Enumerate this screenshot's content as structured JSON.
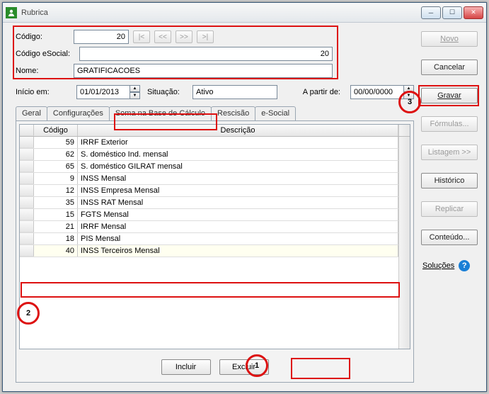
{
  "window": {
    "title": "Rubrica"
  },
  "titlebar_buttons": {
    "min": "─",
    "max": "☐",
    "close": "✕"
  },
  "header": {
    "codigo_label": "Código:",
    "codigo_value": "20",
    "nav": {
      "first": "|<",
      "prev": "<<",
      "next": ">>",
      "last": ">|"
    },
    "esocial_label": "Código eSocial:",
    "esocial_value": "20",
    "nome_label": "Nome:",
    "nome_value": "GRATIFICACOES"
  },
  "meta": {
    "inicio_label": "Início em:",
    "inicio_value": "01/01/2013",
    "situacao_label": "Situação:",
    "situacao_value": "Ativo",
    "apartir_label": "A partir de:",
    "apartir_value": "00/00/0000"
  },
  "tabs": {
    "geral": "Geral",
    "config": "Configurações",
    "soma": "Soma na Base de Cálculo",
    "rescisao": "Rescisão",
    "esocial": "e-Social"
  },
  "grid": {
    "col_codigo": "Código",
    "col_desc": "Descrição",
    "rows": [
      {
        "codigo": "59",
        "desc": "IRRF Exterior"
      },
      {
        "codigo": "62",
        "desc": "S. doméstico Ind. mensal"
      },
      {
        "codigo": "65",
        "desc": "S. doméstico GILRAT mensal"
      },
      {
        "codigo": "9",
        "desc": "INSS Mensal"
      },
      {
        "codigo": "12",
        "desc": "INSS Empresa Mensal"
      },
      {
        "codigo": "35",
        "desc": "INSS RAT Mensal"
      },
      {
        "codigo": "15",
        "desc": "FGTS Mensal"
      },
      {
        "codigo": "21",
        "desc": "IRRF Mensal"
      },
      {
        "codigo": "18",
        "desc": "PIS Mensal"
      },
      {
        "codigo": "40",
        "desc": "INSS Terceiros Mensal"
      }
    ]
  },
  "panel": {
    "incluir": "Incluir",
    "excluir": "Excluir"
  },
  "side": {
    "novo": "Novo",
    "cancelar": "Cancelar",
    "gravar": "Gravar",
    "formulas": "Fórmulas...",
    "listagem": "Listagem >>",
    "historico": "Histórico",
    "replicar": "Replicar",
    "conteudo": "Conteúdo...",
    "solucoes": "Soluções"
  },
  "annotations": {
    "n1": "1",
    "n2": "2",
    "n3": "3"
  }
}
